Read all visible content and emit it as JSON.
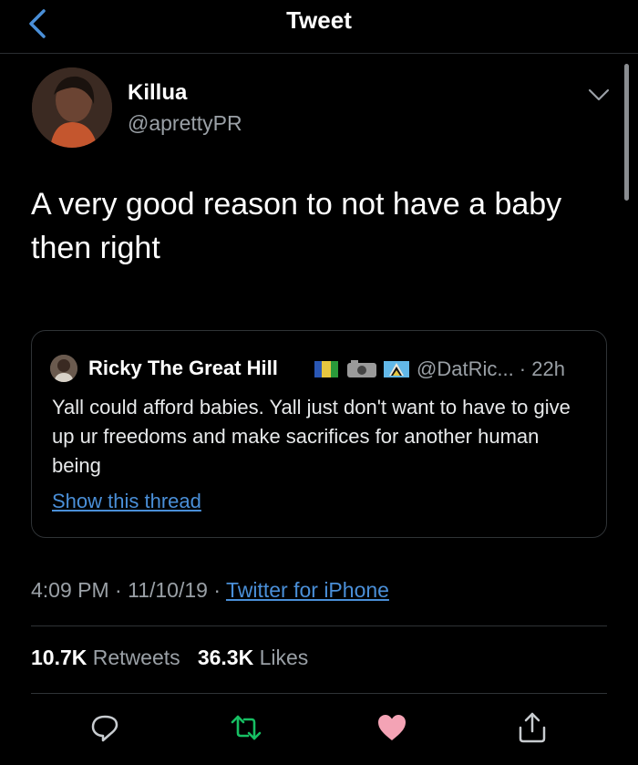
{
  "header": {
    "title": "Tweet"
  },
  "tweet": {
    "author_name": "Killua",
    "author_handle": "@aprettyPR",
    "text": "A very good reason to not have a baby then right",
    "time": "4:09 PM",
    "date": "11/10/19",
    "source": "Twitter for iPhone",
    "sep": " · "
  },
  "quote": {
    "author_name": "Ricky The Great Hill",
    "handle_time": "@DatRic... · 22h",
    "text": "Yall could afford babies. Yall just don't want to have to give up ur freedoms and make sacrifices for another human being",
    "thread_link": "Show this thread"
  },
  "stats": {
    "retweets_count": "10.7K",
    "retweets_label": "Retweets",
    "likes_count": "36.3K",
    "likes_label": "Likes"
  },
  "icons": {
    "back": "chevron-left-icon",
    "more": "chevron-down-icon",
    "reply": "reply-icon",
    "retweet": "retweet-icon",
    "like": "heart-icon",
    "share": "share-icon"
  },
  "colors": {
    "background": "#000000",
    "accent": "#4a8fd8",
    "retweet": "#17bf63",
    "like": "#f4a3b5",
    "secondary_text": "#9aa0a6"
  }
}
